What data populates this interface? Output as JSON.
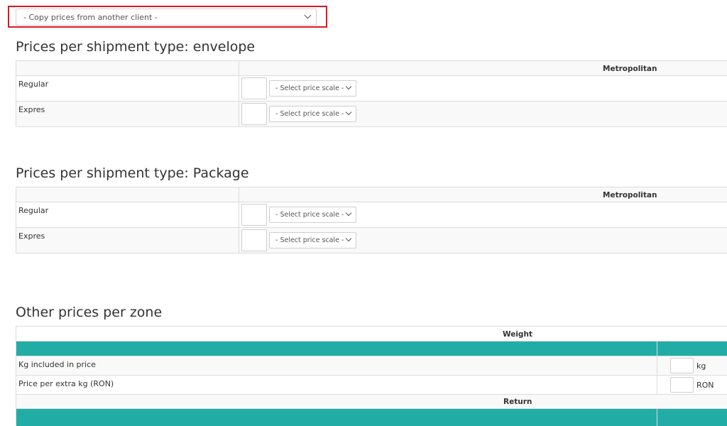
{
  "copy_select": {
    "value": "- Copy prices from another client -"
  },
  "envelope_section": {
    "title": "Prices per shipment type: envelope",
    "zone_header": "Metropolitan",
    "rows": [
      {
        "label": "Regular",
        "price": "",
        "scale": "- Select price scale -"
      },
      {
        "label": "Expres",
        "price": "",
        "scale": "- Select price scale -"
      }
    ]
  },
  "package_section": {
    "title": "Prices per shipment type: Package",
    "zone_header": "Metropolitan",
    "rows": [
      {
        "label": "Regular",
        "price": "",
        "scale": "- Select price scale -"
      },
      {
        "label": "Expres",
        "price": "",
        "scale": "- Select price scale -"
      }
    ]
  },
  "other_section": {
    "title": "Other prices per zone",
    "weight_header": "Weight",
    "rows": [
      {
        "label": "Kg included in price",
        "value": "",
        "unit": "kg"
      },
      {
        "label": "Price per extra kg (RON)",
        "value": "",
        "unit": "RON"
      }
    ],
    "return_header": "Return"
  },
  "colors": {
    "accent_teal": "#21ada6",
    "highlight_red": "#e0171f"
  }
}
